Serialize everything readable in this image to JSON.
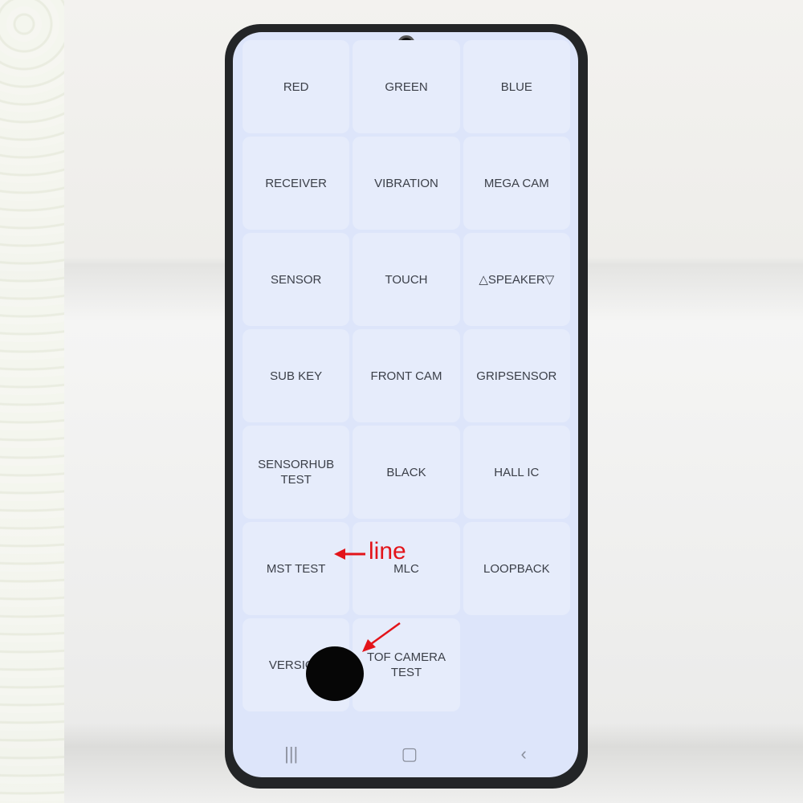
{
  "menu_items": [
    "RED",
    "GREEN",
    "BLUE",
    "RECEIVER",
    "VIBRATION",
    "MEGA CAM",
    "SENSOR",
    "TOUCH",
    "△SPEAKER▽",
    "SUB KEY",
    "FRONT CAM",
    "GRIPSENSOR",
    "SENSORHUB\nTEST",
    "BLACK",
    "HALL IC",
    "MST TEST",
    "MLC",
    "LOOPBACK",
    "VERSION",
    "TOF CAMERA\nTEST"
  ],
  "annotation": {
    "label": "line",
    "color": "#e3141a"
  },
  "nav": {
    "recents": "|||",
    "home": "▢",
    "back": "‹"
  }
}
